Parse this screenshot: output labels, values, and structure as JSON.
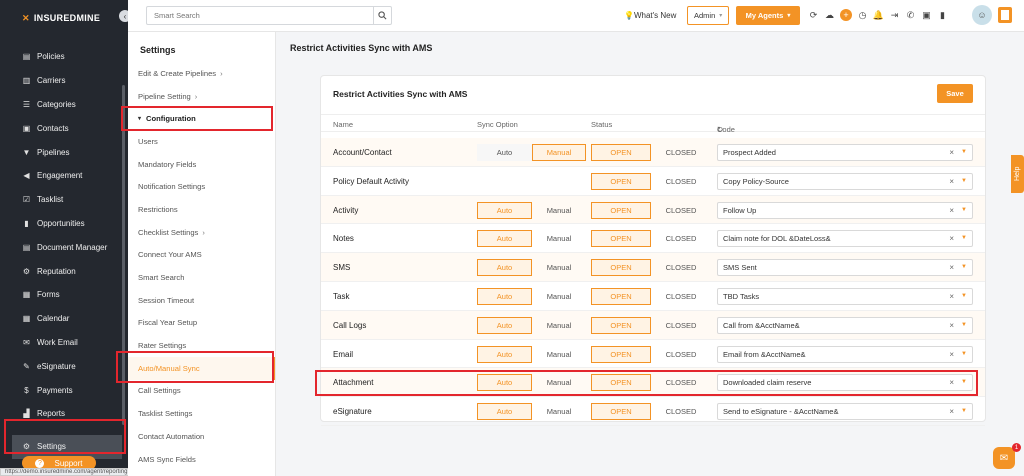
{
  "brand": {
    "name": "INSUREDMINE",
    "accent": "#f39325",
    "sidebar_bg": "#24282f",
    "highlight": "#e3262d"
  },
  "sidebar": {
    "items": [
      {
        "label": "Policies",
        "icon": "policy-icon"
      },
      {
        "label": "Carriers",
        "icon": "carriers-icon"
      },
      {
        "label": "Categories",
        "icon": "categories-icon"
      },
      {
        "label": "Contacts",
        "icon": "contacts-icon"
      },
      {
        "label": "Pipelines",
        "icon": "pipelines-icon"
      },
      {
        "label": "Engagement",
        "icon": "megaphone-icon"
      },
      {
        "label": "Tasklist",
        "icon": "tasklist-icon"
      },
      {
        "label": "Opportunities",
        "icon": "chart-icon"
      },
      {
        "label": "Document Manager",
        "icon": "document-icon"
      },
      {
        "label": "Reputation",
        "icon": "reputation-icon"
      },
      {
        "label": "Forms",
        "icon": "forms-icon"
      },
      {
        "label": "Calendar",
        "icon": "calendar-icon"
      },
      {
        "label": "Work Email",
        "icon": "email-icon"
      },
      {
        "label": "eSignature",
        "icon": "signature-icon"
      },
      {
        "label": "Payments",
        "icon": "payments-icon"
      },
      {
        "label": "Reports",
        "icon": "reports-icon"
      },
      {
        "label": "Settings",
        "icon": "gear-icon"
      }
    ],
    "support_label": "Support",
    "status_url": "https://demo.insuredmine.com/agent/reporting"
  },
  "topbar": {
    "search_placeholder": "Smart Search",
    "whats_new": "What's New",
    "role": "Admin",
    "agents_label": "My Agents"
  },
  "subnav": {
    "title": "Settings",
    "items": [
      {
        "label": "Edit & Create Pipelines",
        "arrow": "›"
      },
      {
        "label": "Pipeline Setting",
        "arrow": "›"
      },
      {
        "label": "Configuration"
      },
      {
        "label": "Users"
      },
      {
        "label": "Mandatory Fields"
      },
      {
        "label": "Notification Settings"
      },
      {
        "label": "Restrictions"
      },
      {
        "label": "Checklist Settings",
        "arrow": "›"
      },
      {
        "label": "Connect Your AMS"
      },
      {
        "label": "Smart Search"
      },
      {
        "label": "Session Timeout"
      },
      {
        "label": "Fiscal Year Setup"
      },
      {
        "label": "Rater Settings"
      },
      {
        "label": "Auto/Manual Sync"
      },
      {
        "label": "Call Settings"
      },
      {
        "label": "Tasklist Settings"
      },
      {
        "label": "Contact Automation"
      },
      {
        "label": "AMS Sync Fields"
      }
    ]
  },
  "main": {
    "page_title": "Restrict Activities Sync with AMS",
    "card_title": "Restrict Activities Sync with AMS",
    "save_label": "Save",
    "headers": {
      "name": "Name",
      "sync": "Sync Option",
      "status": "Status",
      "code": "Code"
    },
    "auto_label": "Auto",
    "manual_label": "Manual",
    "open_label": "OPEN",
    "closed_label": "CLOSED",
    "rows": [
      {
        "name": "Account/Contact",
        "sync": "Manual",
        "status": "OPEN",
        "code": "Prospect Added"
      },
      {
        "name": "Policy Default Activity",
        "sync": "",
        "status": "OPEN",
        "code": "Copy Policy-Source"
      },
      {
        "name": "Activity",
        "sync": "Auto",
        "status": "OPEN",
        "code": "Follow Up"
      },
      {
        "name": "Notes",
        "sync": "Auto",
        "status": "OPEN",
        "code": "Claim note for DOL &DateLoss&"
      },
      {
        "name": "SMS",
        "sync": "Auto",
        "status": "OPEN",
        "code": "SMS Sent"
      },
      {
        "name": "Task",
        "sync": "Auto",
        "status": "OPEN",
        "code": "TBD Tasks"
      },
      {
        "name": "Call Logs",
        "sync": "Auto",
        "status": "OPEN",
        "code": "Call from &AcctName&"
      },
      {
        "name": "Email",
        "sync": "Auto",
        "status": "OPEN",
        "code": "Email from &AcctName&"
      },
      {
        "name": "Attachment",
        "sync": "Auto",
        "status": "OPEN",
        "code": "Downloaded claim reserve"
      },
      {
        "name": "eSignature",
        "sync": "Auto",
        "status": "OPEN",
        "code": "Send to eSignature - &AcctName&"
      }
    ]
  },
  "help_label": "Help",
  "chat_badge": "1"
}
